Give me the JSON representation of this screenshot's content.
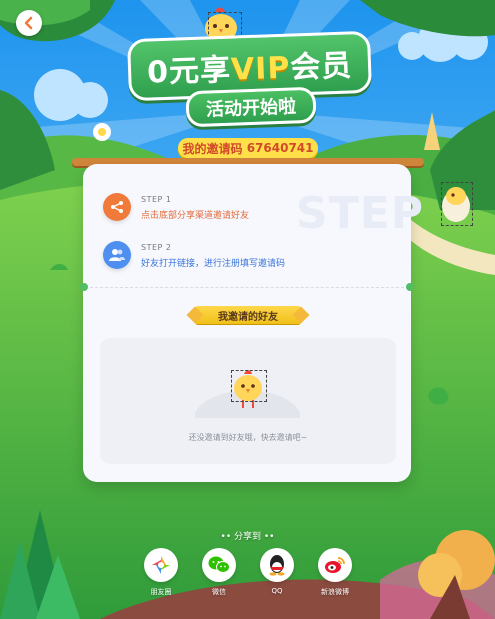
{
  "header": {
    "back_icon": "chevron-left-icon",
    "title_prefix": "0元享",
    "title_vip": "VIP",
    "title_suffix": "会员",
    "subtitle": "活动开始啦"
  },
  "invite_code": {
    "label": "我的邀请码",
    "code": "67640741"
  },
  "steps": [
    {
      "label": "STEP 1",
      "text": "点击底部分享渠道邀请好友",
      "icon": "share-icon",
      "color": "#f07a3a"
    },
    {
      "label": "STEP 2",
      "text": "好友打开链接，进行注册填写邀请码",
      "icon": "users-icon",
      "color": "#4e8ff0"
    }
  ],
  "steps_watermark": "STEP",
  "invited_section": {
    "title": "我邀请的好友",
    "empty_text": "还没邀请到好友哦，快去邀请吧~"
  },
  "share": {
    "title": "•• 分享到 ••",
    "channels": [
      {
        "label": "朋友圈",
        "icon": "moments-icon"
      },
      {
        "label": "微信",
        "icon": "wechat-icon"
      },
      {
        "label": "QQ",
        "icon": "qq-icon"
      },
      {
        "label": "新浪微博",
        "icon": "weibo-icon"
      }
    ]
  },
  "colors": {
    "sky": "#46a8f0",
    "grass": "#5fc14d",
    "accent_orange": "#f07a3a",
    "accent_blue": "#4e8ff0",
    "code_text": "#d14a2a",
    "ribbon": "#f0c01a"
  }
}
